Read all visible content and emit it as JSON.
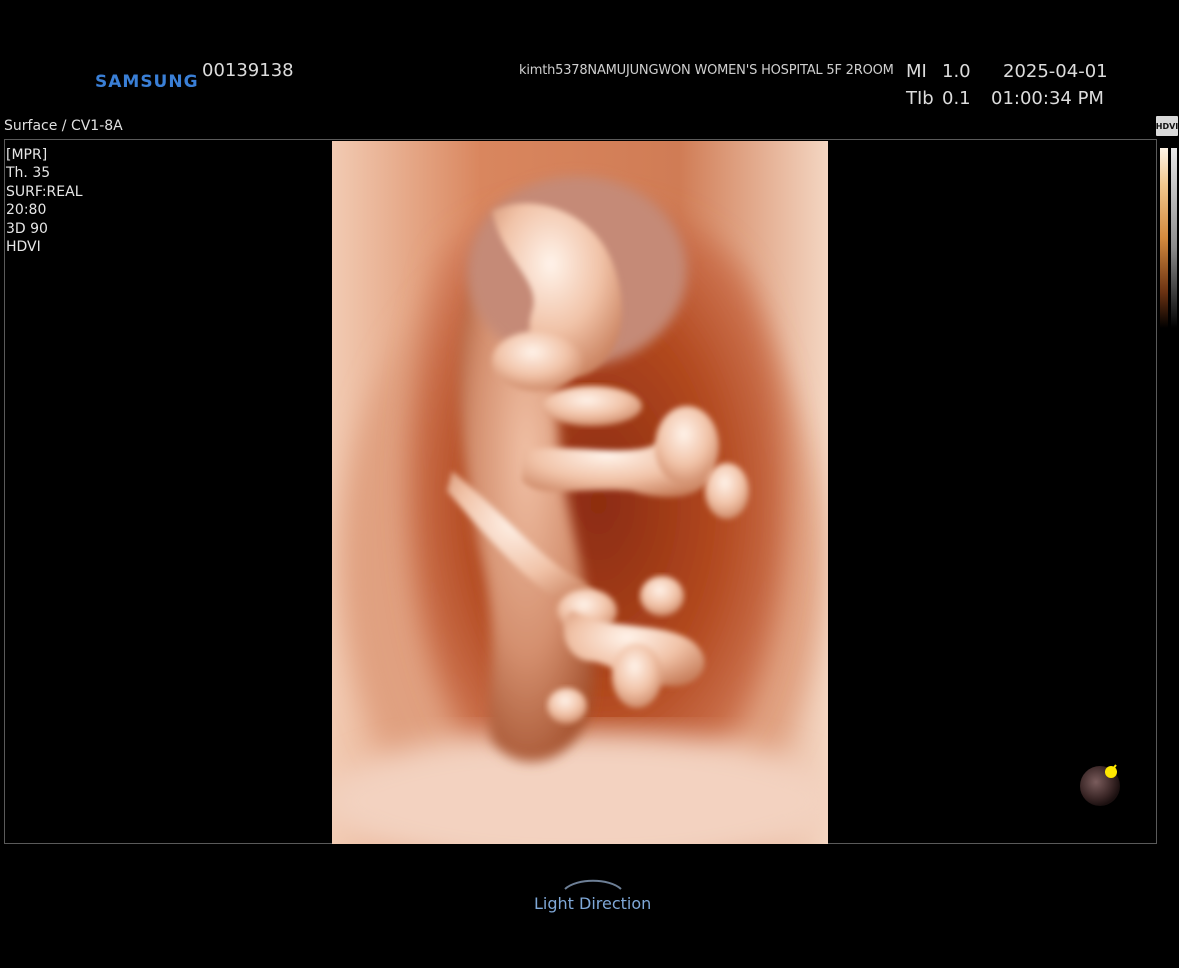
{
  "header": {
    "brand": "SAMSUNG",
    "patient_id": "00139138",
    "user_hospital": "kimth5378NAMUJUNGWON WOMEN'S HOSPITAL 5F 2ROOM",
    "mi_label": "MI",
    "mi_value": "1.0",
    "tib_label": "TIb",
    "tib_value": "0.1",
    "date": "2025-04-01",
    "time": "01:00:34 PM"
  },
  "mode": "Surface / CV1-8A",
  "hdvi_badge": "HDVI",
  "params": [
    "[MPR]",
    "Th. 35",
    "SURF:REAL",
    "20:80",
    "3D 90",
    "HDVI"
  ],
  "light": {
    "label": "Light Direction",
    "icon": "light-direction-ball-icon"
  },
  "colors": {
    "brand": "#3a7fd6",
    "light_label": "#7fa8d8",
    "render_base": "#c76e4a",
    "light_dot": "#ffe800"
  }
}
